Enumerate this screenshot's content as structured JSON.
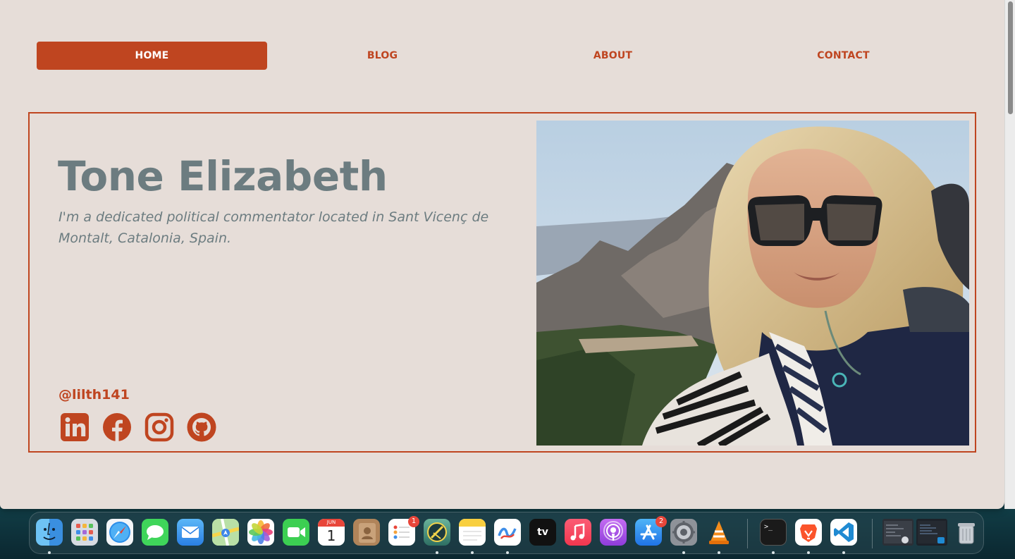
{
  "nav": {
    "home": "HOME",
    "blog": "BLOG",
    "about": "ABOUT",
    "contact": "CONTACT",
    "active": "HOME"
  },
  "hero": {
    "name": "Tone Elizabeth",
    "bio": "I'm a dedicated political commentator located in Sant Vicenç de Montalt, Catalonia, Spain.",
    "handle": "@lilth141",
    "socials": [
      "linkedin-icon",
      "facebook-icon",
      "instagram-icon",
      "github-icon"
    ]
  },
  "colors": {
    "accent": "#bf4520",
    "page_bg": "#e6ddd8",
    "text_muted": "#6c7c80"
  },
  "dock": {
    "apps": [
      "Finder",
      "Launchpad",
      "Safari",
      "Messages",
      "Mail",
      "Maps",
      "Photos",
      "FaceTime",
      "Calendar",
      "Contacts",
      "Reminders",
      "Git app",
      "Notes",
      "Freeform",
      "TV",
      "Music",
      "Podcasts",
      "App Store",
      "System Settings",
      "VLC",
      "Terminal",
      "Brave",
      "VS Code",
      "Window thumbnail 1",
      "Window thumbnail 2",
      "Trash"
    ],
    "calendar_month": "JUN",
    "calendar_day": "1",
    "tv_label": "tv",
    "reminders_badge": "1",
    "appstore_badge": "2",
    "terminal_prompt": ">_"
  }
}
